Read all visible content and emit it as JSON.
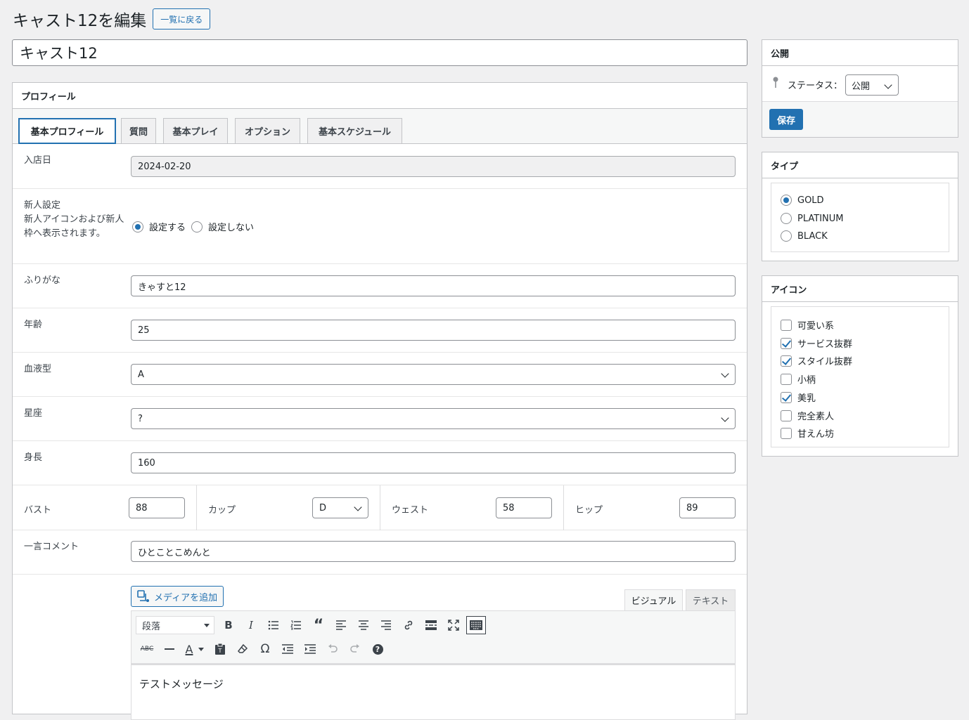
{
  "page": {
    "title": "キャスト12を編集",
    "back_label": "一覧に戻る",
    "post_title": "キャスト12"
  },
  "profile": {
    "heading": "プロフィール",
    "tabs": [
      "基本プロフィール",
      "質問",
      "基本プレイ",
      "オプション",
      "基本スケジュール"
    ],
    "join_date": {
      "label": "入店日",
      "value": "2024-02-20"
    },
    "newcomer": {
      "label": "新人設定",
      "help_line1": "新人アイコンおよび新人",
      "help_line2": "枠へ表示されます。",
      "options": [
        "設定する",
        "設定しない"
      ],
      "selected": "設定する"
    },
    "furigana": {
      "label": "ふりがな",
      "value": "きゃすと12"
    },
    "age": {
      "label": "年齢",
      "value": "25"
    },
    "blood": {
      "label": "血液型",
      "value": "A"
    },
    "zodiac": {
      "label": "星座",
      "value": "?"
    },
    "height": {
      "label": "身長",
      "value": "160"
    },
    "bust": {
      "label": "バスト",
      "value": "88"
    },
    "cup": {
      "label": "カップ",
      "value": "D"
    },
    "waist": {
      "label": "ウェスト",
      "value": "58"
    },
    "hip": {
      "label": "ヒップ",
      "value": "89"
    },
    "comment": {
      "label": "一言コメント",
      "value": "ひとことこめんと"
    },
    "editor": {
      "add_media": "メディアを追加",
      "tab_visual": "ビジュアル",
      "tab_text": "テキスト",
      "format_select": "段落",
      "content": "テストメッセージ"
    }
  },
  "publish": {
    "heading": "公開",
    "status_label": "ステータス：",
    "status_value": "公開",
    "save_label": "保存"
  },
  "type": {
    "heading": "タイプ",
    "options": [
      "GOLD",
      "PLATINUM",
      "BLACK"
    ],
    "selected": "GOLD"
  },
  "icons": {
    "heading": "アイコン",
    "items": [
      {
        "label": "可愛い系",
        "checked": false
      },
      {
        "label": "サービス抜群",
        "checked": true
      },
      {
        "label": "スタイル抜群",
        "checked": true
      },
      {
        "label": "小柄",
        "checked": false
      },
      {
        "label": "美乳",
        "checked": true
      },
      {
        "label": "完全素人",
        "checked": false
      },
      {
        "label": "甘えん坊",
        "checked": false
      }
    ]
  },
  "colors": {
    "accent": "#2271b1",
    "background": "#f0f0f1",
    "border": "#c3c4c7"
  }
}
